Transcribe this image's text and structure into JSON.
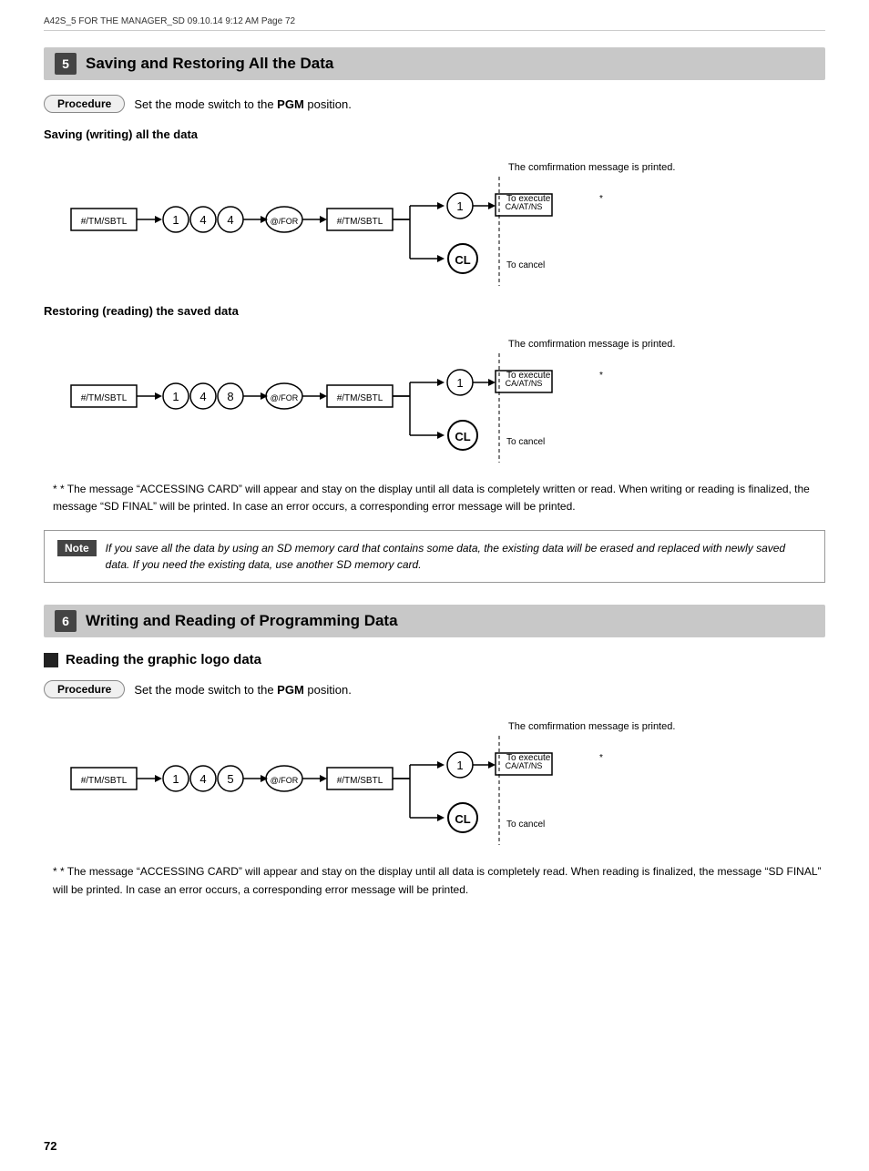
{
  "header": {
    "text": "A42S_5 FOR THE MANAGER_SD  09.10.14 9:12 AM  Page 72"
  },
  "section5": {
    "num": "5",
    "title": "Saving and Restoring All the Data",
    "procedure_label": "Procedure",
    "procedure_text_pre": "Set the mode switch to the ",
    "procedure_text_bold": "PGM",
    "procedure_text_post": " position.",
    "saving_title": "Saving (writing) all the data",
    "restoring_title": "Restoring (reading) the saved data",
    "confirmation_text": "The comfirmation message is printed.",
    "to_execute": "To execute",
    "to_cancel": "To cancel",
    "star": "*",
    "saving_keys": [
      "#/TM/SBTL",
      "1",
      "4",
      "4",
      "@/FOR",
      "#/TM/SBTL",
      "1",
      "CA/AT/NS",
      "CL"
    ],
    "restoring_keys": [
      "#/TM/SBTL",
      "1",
      "4",
      "8",
      "@/FOR",
      "#/TM/SBTL",
      "1",
      "CA/AT/NS",
      "CL"
    ],
    "footnote": "* The message “ACCESSING CARD” will appear and stay on the display until all data is completely written or read. When writing or reading is finalized, the message “SD FINAL” will be printed. In case an error occurs, a corresponding error message will be printed.",
    "note_label": "Note",
    "note_text": "If you save all the data by using an SD memory card that contains some data, the existing data will be erased and replaced with newly saved data. If you need the existing data, use another SD memory card."
  },
  "section6": {
    "num": "6",
    "title": "Writing and Reading of Programming Data",
    "reading_title": "Reading the graphic logo data",
    "procedure_label": "Procedure",
    "procedure_text_pre": "Set the mode switch to the ",
    "procedure_text_bold": "PGM",
    "procedure_text_post": " position.",
    "confirmation_text": "The comfirmation message is printed.",
    "to_execute": "To execute",
    "to_cancel": "To cancel",
    "star": "*",
    "reading_keys": [
      "#/TM/SBTL",
      "1",
      "4",
      "5",
      "@/FOR",
      "#/TM/SBTL",
      "1",
      "CA/AT/NS",
      "CL"
    ],
    "footnote": "* The message “ACCESSING CARD” will appear and stay on the display until all data is completely read. When reading is finalized, the message “SD FINAL” will be printed. In case an error occurs, a corresponding error message will be printed."
  },
  "page_number": "72"
}
